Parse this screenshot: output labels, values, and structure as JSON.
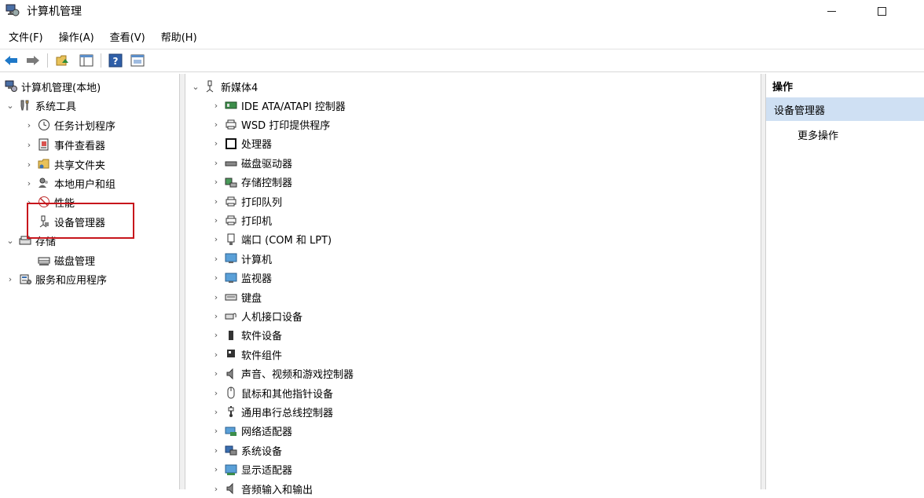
{
  "window": {
    "title": "计算机管理"
  },
  "menubar": [
    {
      "label": "文件(F)"
    },
    {
      "label": "操作(A)"
    },
    {
      "label": "查看(V)"
    },
    {
      "label": "帮助(H)"
    }
  ],
  "toolbar": {
    "buttons": [
      "back-arrow-icon",
      "forward-arrow-icon",
      "up-folder-icon",
      "show-hide-tree-icon",
      "help-icon",
      "properties-icon"
    ]
  },
  "tree": {
    "root": "计算机管理(本地)",
    "system_tools": "系统工具",
    "task_scheduler": "任务计划程序",
    "event_viewer": "事件查看器",
    "shared_folders": "共享文件夹",
    "local_users": "本地用户和组",
    "performance": "性能",
    "device_manager": "设备管理器",
    "storage": "存储",
    "disk_management": "磁盘管理",
    "services_apps": "服务和应用程序"
  },
  "devices": {
    "computer_name": "新媒体4",
    "categories": [
      "IDE ATA/ATAPI 控制器",
      "WSD 打印提供程序",
      "处理器",
      "磁盘驱动器",
      "存储控制器",
      "打印队列",
      "打印机",
      "端口 (COM 和 LPT)",
      "计算机",
      "监视器",
      "键盘",
      "人机接口设备",
      "软件设备",
      "软件组件",
      "声音、视频和游戏控制器",
      "鼠标和其他指针设备",
      "通用串行总线控制器",
      "网络适配器",
      "系统设备",
      "显示适配器",
      "音频输入和输出"
    ]
  },
  "actions": {
    "header": "操作",
    "selected": "设备管理器",
    "more": "更多操作"
  },
  "colors": {
    "highlight_border": "#c7161c",
    "selection_bg": "#cfe0f3",
    "accent_blue": "#1e78c8"
  }
}
